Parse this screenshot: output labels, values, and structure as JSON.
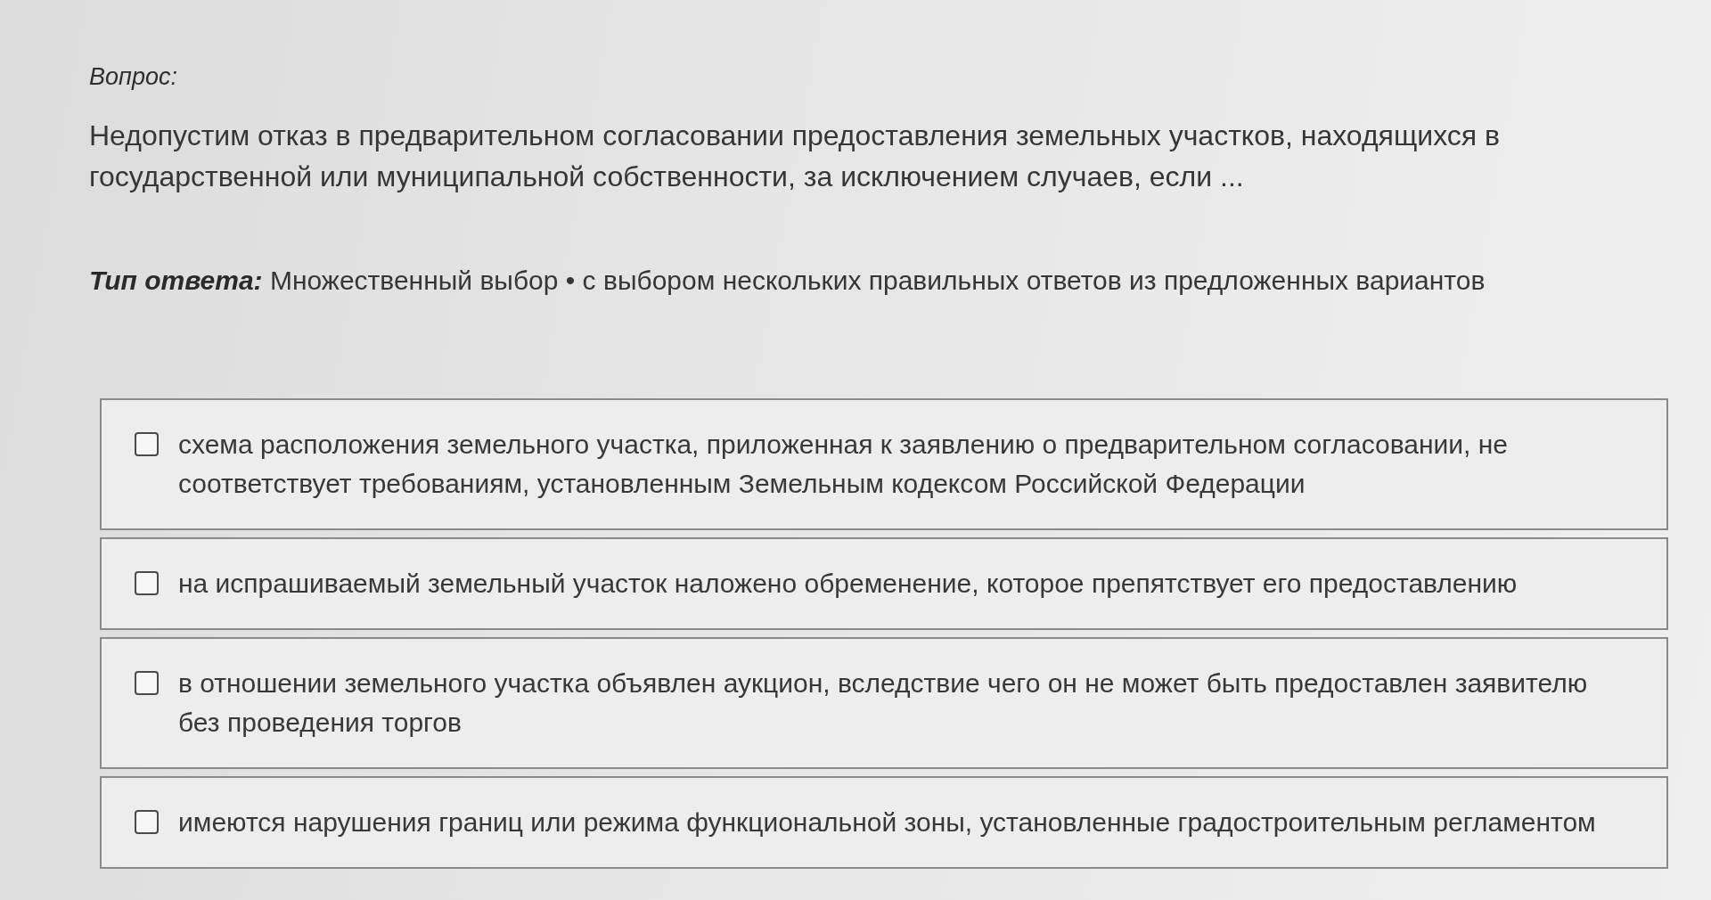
{
  "question": {
    "label": "Вопрос:",
    "text": "Недопустим отказ в предварительном согласовании предоставления земельных участков, находящихся в государственной или муниципальной собственности, за исключением случаев, если ..."
  },
  "answer_type": {
    "text": "*Тип ответа:* Множественный выбор • с выбором нескольких правильных ответов из предложенных вариантов"
  },
  "options": [
    {
      "text": "схема расположения земельного участка, приложенная к заявлению о предварительном согласовании, не соответствует требованиям, установленным Земельным кодексом Российской Федерации",
      "checked": false
    },
    {
      "text": "на испрашиваемый земельный участок наложено обременение, которое препятствует его предоставлению",
      "checked": false
    },
    {
      "text": "в отношении земельного участка объявлен аукцион, вследствие чего он не может быть предоставлен заявителю без проведения торгов",
      "checked": false
    },
    {
      "text": "имеются нарушения границ или режима функциональной зоны, установленные градостроительным регламентом",
      "checked": false
    }
  ]
}
